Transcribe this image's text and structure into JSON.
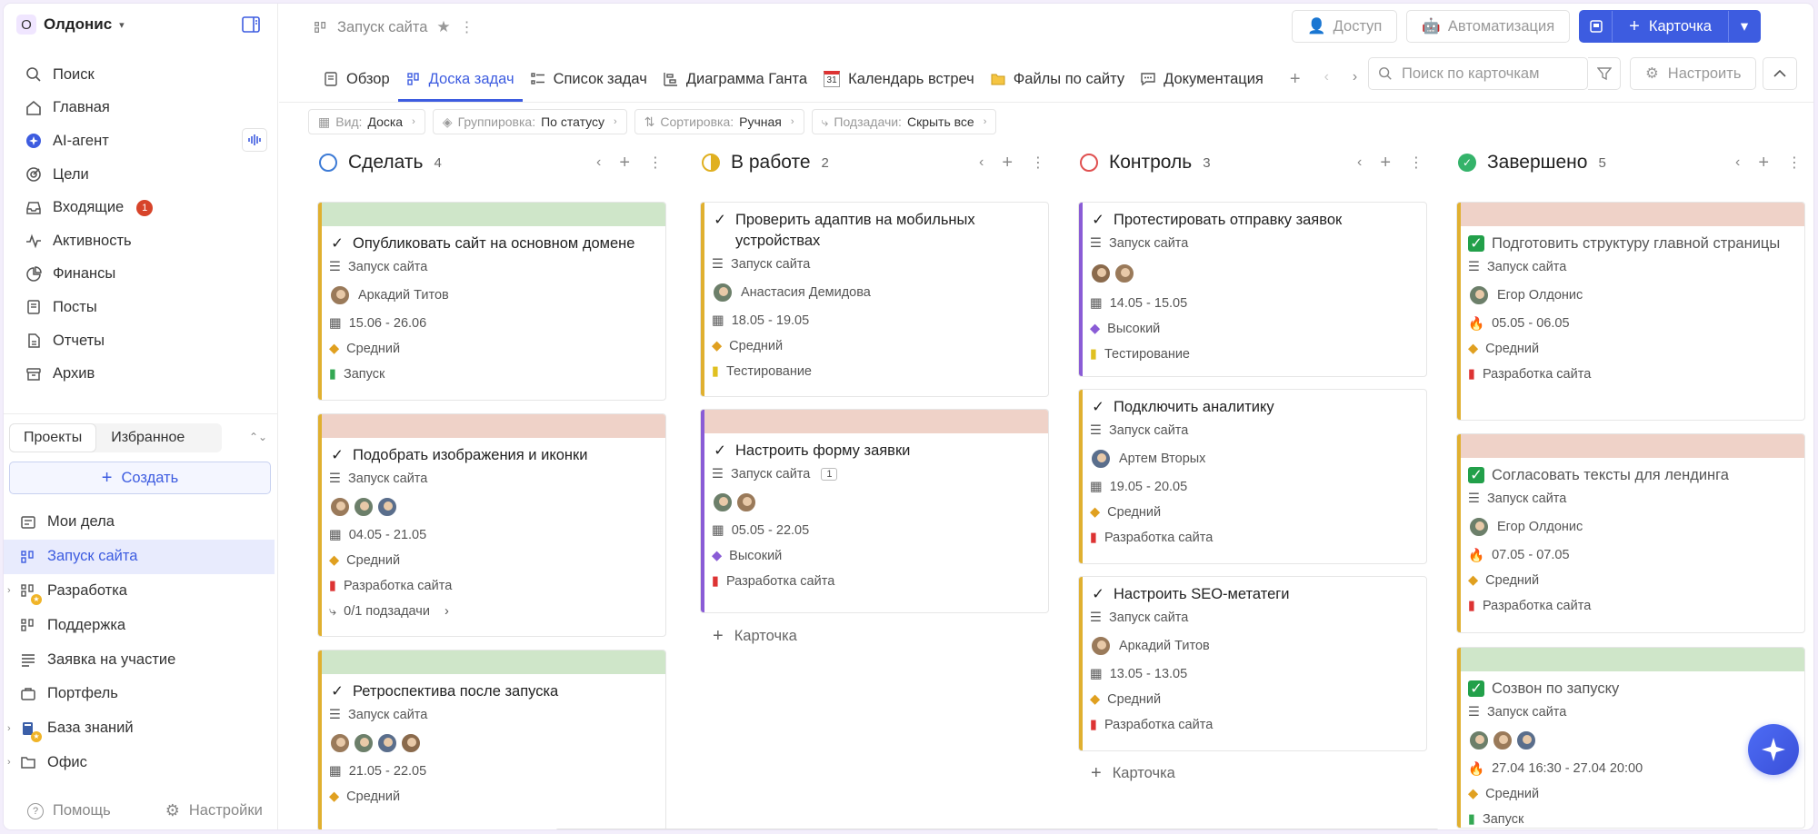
{
  "org": {
    "badge": "О",
    "name": "Олдонис"
  },
  "nav": [
    {
      "label": "Поиск",
      "icon": "search-icon"
    },
    {
      "label": "Главная",
      "icon": "home-icon"
    },
    {
      "label": "AI-агент",
      "icon": "ai-agent-icon"
    },
    {
      "label": "Цели",
      "icon": "target-icon"
    },
    {
      "label": "Входящие",
      "icon": "inbox-icon",
      "count": "1"
    },
    {
      "label": "Активность",
      "icon": "activity-icon"
    },
    {
      "label": "Финансы",
      "icon": "finance-icon"
    },
    {
      "label": "Посты",
      "icon": "posts-icon"
    },
    {
      "label": "Отчеты",
      "icon": "reports-icon"
    },
    {
      "label": "Архив",
      "icon": "archive-icon"
    }
  ],
  "sidebar_tabs": {
    "projects": "Проекты",
    "favorites": "Избранное"
  },
  "create_label": "Создать",
  "projects": [
    {
      "label": "Мои дела",
      "icon": "my-tasks-icon"
    },
    {
      "label": "Запуск сайта",
      "icon": "board-icon",
      "active": true
    },
    {
      "label": "Разработка",
      "icon": "board-icon",
      "expandable": true,
      "starred": true
    },
    {
      "label": "Поддержка",
      "icon": "board-icon"
    },
    {
      "label": "Заявка на участие",
      "icon": "form-icon"
    },
    {
      "label": "Портфель",
      "icon": "portfolio-icon"
    },
    {
      "label": "База знаний",
      "icon": "knowledge-icon",
      "expandable": true,
      "starred": true
    },
    {
      "label": "Офис",
      "icon": "folder-icon",
      "expandable": true
    }
  ],
  "footer": {
    "help": "Помощь",
    "settings": "Настройки"
  },
  "breadcrumb": {
    "title": "Запуск сайта"
  },
  "top_actions": {
    "access": "Доступ",
    "automation": "Автоматизация",
    "card": "Карточка"
  },
  "tabs": [
    {
      "label": "Обзор",
      "icon": "overview-icon"
    },
    {
      "label": "Доска задач",
      "icon": "board-icon",
      "active": true
    },
    {
      "label": "Список задач",
      "icon": "list-icon"
    },
    {
      "label": "Диаграмма Ганта",
      "icon": "gantt-icon"
    },
    {
      "label": "Календарь встреч",
      "icon": "calendar-icon",
      "cal_num": "31"
    },
    {
      "label": "Файлы по сайту",
      "icon": "folder-icon"
    },
    {
      "label": "Документация",
      "icon": "chat-icon"
    }
  ],
  "search": {
    "placeholder": "Поиск по карточкам"
  },
  "configure_label": "Настроить",
  "filters": [
    {
      "key": "Вид:",
      "value": "Доска",
      "icon": "board-icon"
    },
    {
      "key": "Группировка:",
      "value": "По статусу",
      "icon": "layers-icon"
    },
    {
      "key": "Сортировка:",
      "value": "Ручная",
      "icon": "sort-icon"
    },
    {
      "key": "Подзадачи:",
      "value": "Скрыть все",
      "icon": "subtask-icon"
    }
  ],
  "colors": {
    "accent": "#3d5ce0",
    "yellow": "#e0b030",
    "purple": "#8a5cd6",
    "green_cover": "#cfe6c9",
    "pink_cover": "#efd2c8",
    "done": "#22a04a"
  },
  "columns": [
    {
      "name": "Сделать",
      "count": "4",
      "status": "todo"
    },
    {
      "name": "В работе",
      "count": "2",
      "status": "progress"
    },
    {
      "name": "Контроль",
      "count": "3",
      "status": "review"
    },
    {
      "name": "Завершено",
      "count": "5",
      "status": "done"
    }
  ],
  "cards": {
    "c1": {
      "title": "Опубликовать сайт на основном домене",
      "project": "Запуск сайта",
      "assignee": "Аркадий Титов",
      "dates": "15.06 - 26.06",
      "priority": "Средний",
      "tag": "Запуск"
    },
    "c2": {
      "title": "Подобрать изображения и иконки",
      "project": "Запуск сайта",
      "dates": "04.05 - 21.05",
      "priority": "Средний",
      "tag": "Разработка сайта",
      "subtasks": "0/1 подзадачи"
    },
    "c3": {
      "title": "Ретроспектива после запуска",
      "project": "Запуск сайта",
      "dates": "21.05 - 22.05",
      "priority": "Средний"
    },
    "c4": {
      "title": "Проверить адаптив на мобильных устройствах",
      "project": "Запуск сайта",
      "assignee": "Анастасия Демидова",
      "dates": "18.05 - 19.05",
      "priority": "Средний",
      "tag": "Тестирование"
    },
    "c5": {
      "title": "Настроить форму заявки",
      "project": "Запуск сайта",
      "badge": "1",
      "dates": "05.05 - 22.05",
      "priority": "Высокий",
      "tag": "Разработка сайта"
    },
    "c6": {
      "title": "Протестировать отправку заявок",
      "project": "Запуск сайта",
      "dates": "14.05 - 15.05",
      "priority": "Высокий",
      "tag": "Тестирование"
    },
    "c7": {
      "title": "Подключить аналитику",
      "project": "Запуск сайта",
      "assignee": "Артем Вторых",
      "dates": "19.05 - 20.05",
      "priority": "Средний",
      "tag": "Разработка сайта"
    },
    "c8": {
      "title": "Настроить SEO-метатеги",
      "project": "Запуск сайта",
      "assignee": "Аркадий Титов",
      "dates": "13.05 - 13.05",
      "priority": "Средний",
      "tag": "Разработка сайта"
    },
    "c9": {
      "title": "Подготовить структуру главной страницы",
      "project": "Запуск сайта",
      "assignee": "Егор Олдонис",
      "dates": "05.05 - 06.05",
      "priority": "Средний",
      "tag": "Разработка сайта"
    },
    "c10": {
      "title": "Согласовать тексты для лендинга",
      "project": "Запуск сайта",
      "assignee": "Егор Олдонис",
      "dates": "07.05 - 07.05",
      "priority": "Средний",
      "tag": "Разработка сайта"
    },
    "c11": {
      "title": "Созвон по запуску",
      "project": "Запуск сайта",
      "dates": "27.04 16:30 - 27.04 20:00",
      "priority": "Средний",
      "tag": "Запуск"
    }
  },
  "add_card_label": "Карточка"
}
